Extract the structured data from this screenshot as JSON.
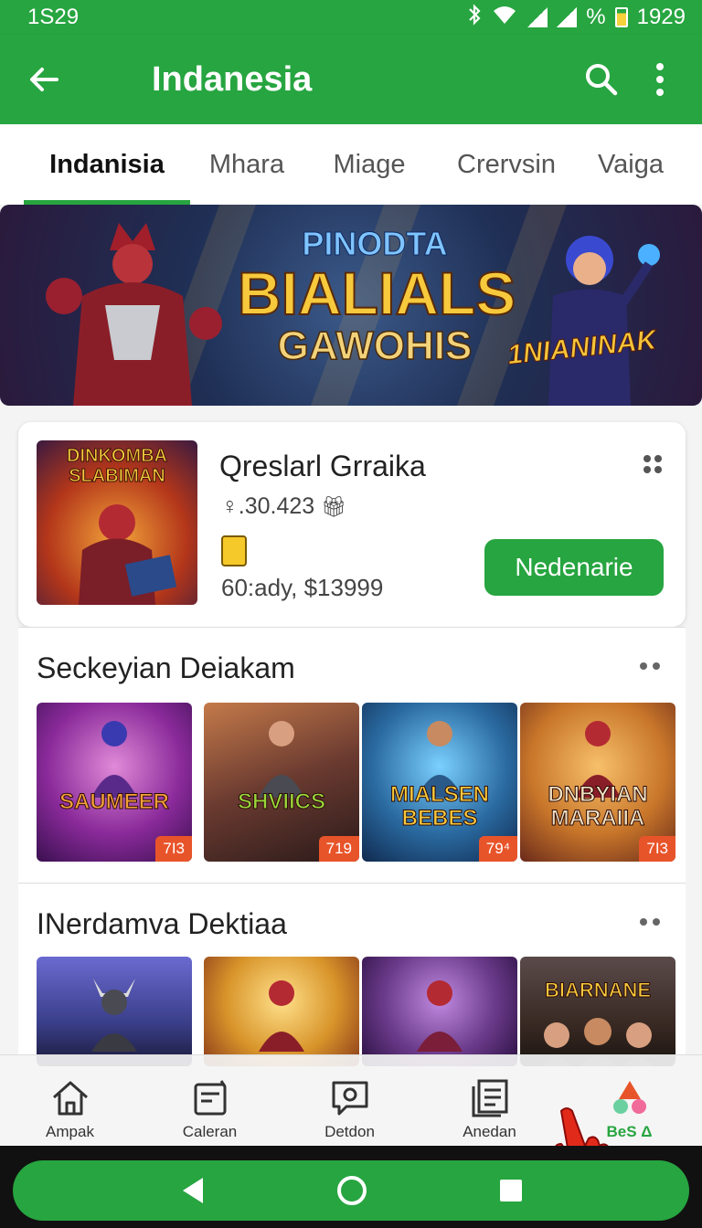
{
  "status": {
    "time_left": "1S29",
    "battery_text": "%",
    "time_right": "1929"
  },
  "appbar": {
    "title": "Indanesia"
  },
  "tabs": [
    {
      "label": "Indanisia"
    },
    {
      "label": "Mhara"
    },
    {
      "label": "Miage"
    },
    {
      "label": "Crervsin"
    },
    {
      "label": "Vaiga"
    }
  ],
  "banner": {
    "line1": "PINODTA",
    "line2": "BIALIALS",
    "line3": "GAWOHIS",
    "sub": "1NIANINAK"
  },
  "featured": {
    "thumb_title": "DINKOMBA SLABIMAN",
    "title": "Qreslarl Grraika",
    "meta": "♀.30.423",
    "price": "60:ady, $13999",
    "button": "Nedenarie"
  },
  "sections": [
    {
      "title": "Seckeyian Deiakam",
      "items": [
        {
          "label": "SAUMEER",
          "badge": "7I3",
          "color": "#c23a8a"
        },
        {
          "label": "SHVIICS",
          "badge": "719",
          "color": "#7a4b3a"
        },
        {
          "label": "MIALSEN BEBES",
          "badge": "79⁴",
          "color": "#2a6aa0"
        },
        {
          "label": "DNBYIAN MARAIIA",
          "badge": "7I3",
          "color": "#c8762a"
        }
      ]
    },
    {
      "title": "INerdamva Dektiaa",
      "items": [
        {
          "label": "",
          "color": "#3a3f8a"
        },
        {
          "label": "",
          "color": "#d8942a"
        },
        {
          "label": "",
          "color": "#6a3a8a"
        },
        {
          "label": "BIARNANE",
          "color": "#3a2a24"
        }
      ]
    }
  ],
  "bottom_nav": [
    {
      "label": "Ampak",
      "icon": "home-icon"
    },
    {
      "label": "Caleran",
      "icon": "calendar-icon"
    },
    {
      "label": "Detdon",
      "icon": "chat-icon"
    },
    {
      "label": "Anedan",
      "icon": "list-icon"
    },
    {
      "label": "BeS Δ",
      "icon": "games-icon"
    }
  ],
  "colors": {
    "primary": "#27a540",
    "accent": "#e8542a",
    "title_gold": "#f7c93c"
  }
}
